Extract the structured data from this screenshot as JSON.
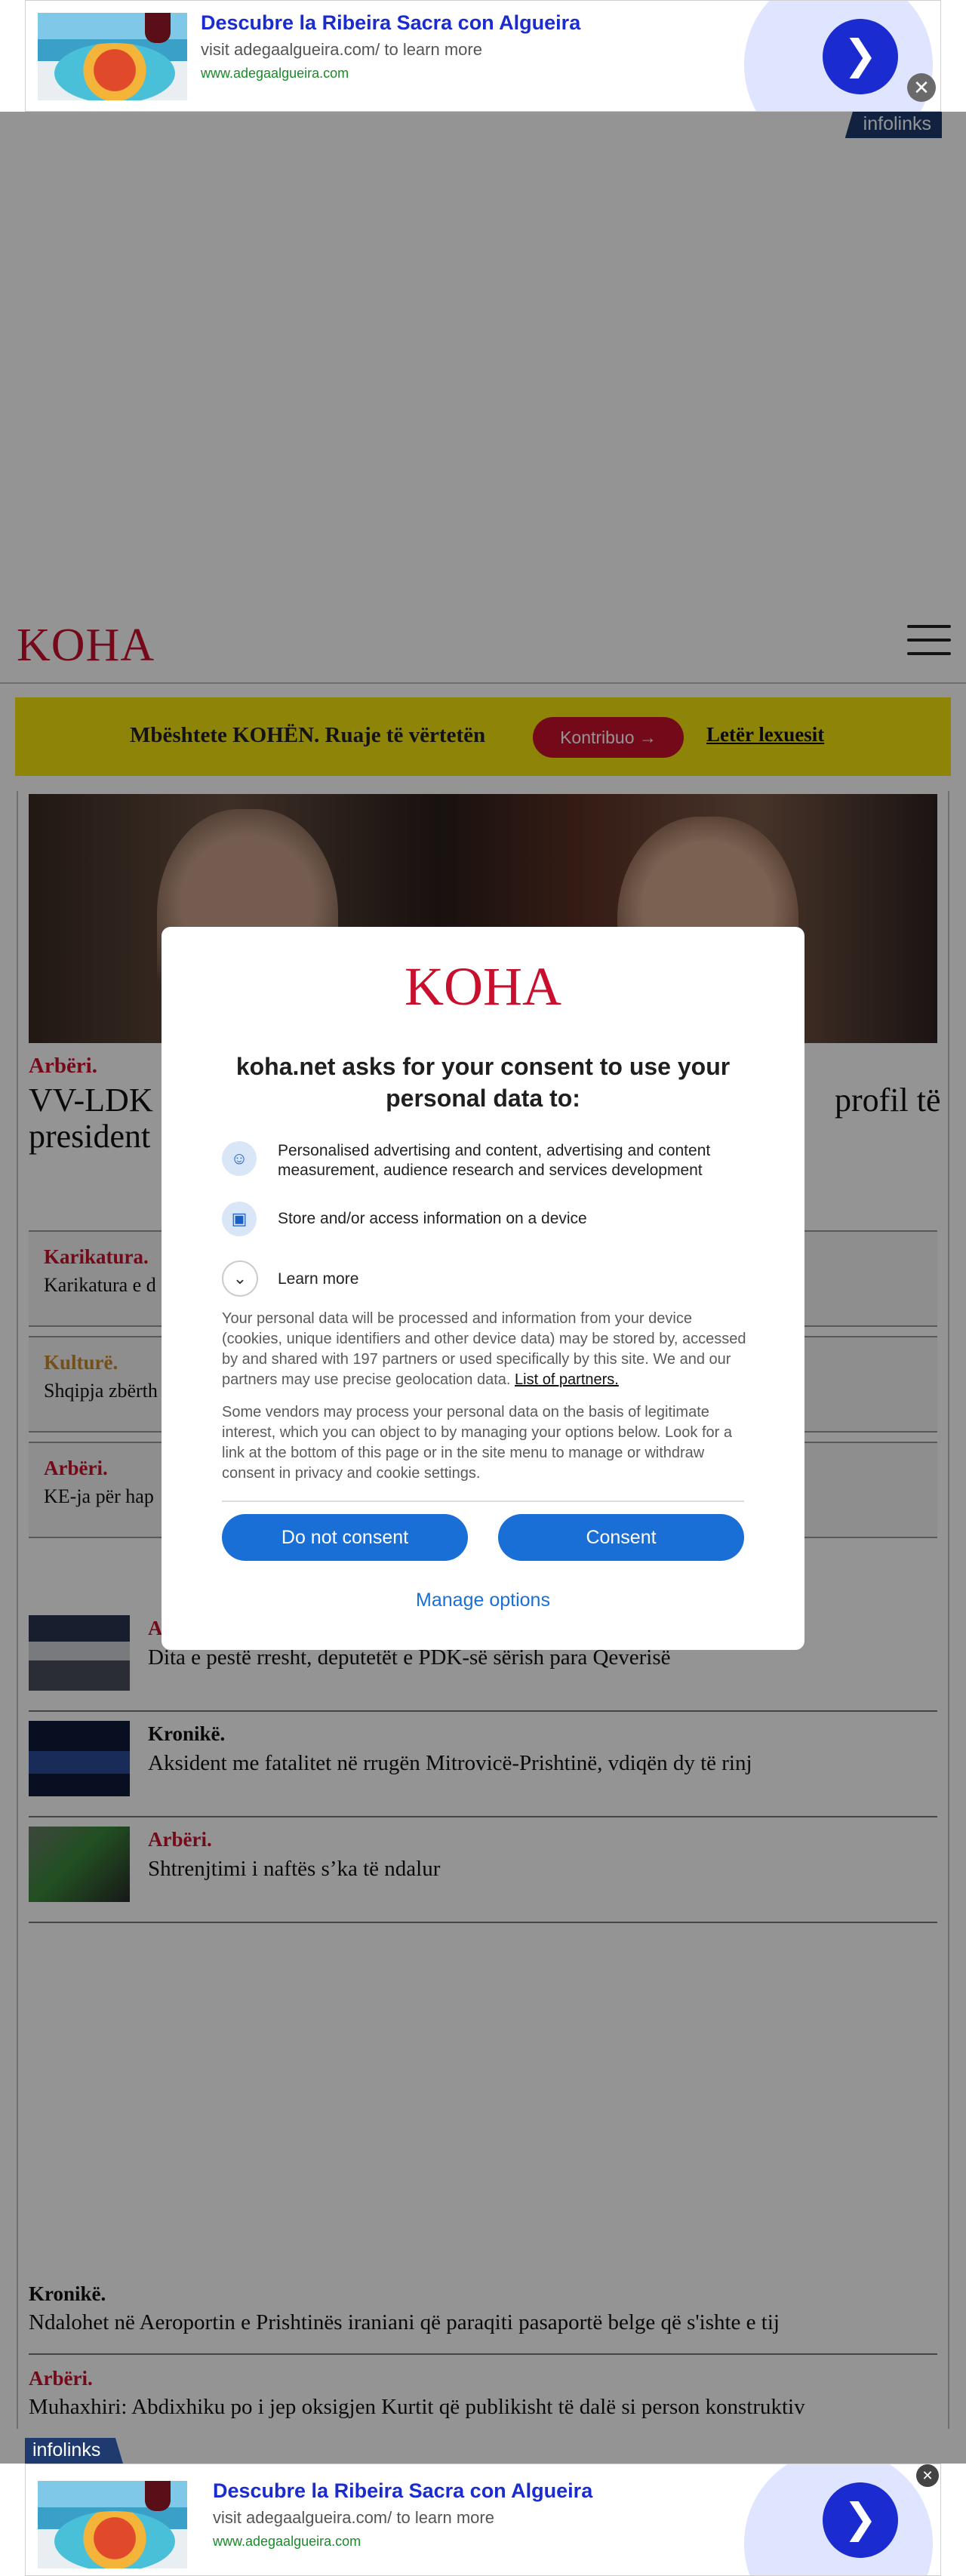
{
  "ad": {
    "title": "Descubre la Ribeira Sacra con Algueira",
    "subtitle": "visit adegaalgueira.com/ to learn more",
    "url": "www.adegaalgueira.com",
    "brand": "infolinks"
  },
  "header": {
    "logo": "KOHA"
  },
  "support": {
    "text": "Mbështete KOHËN. Ruaje të vërtetën",
    "button": "Kontribuo",
    "letter": "Letër lexuesit"
  },
  "hero": {
    "kicker": "Arbëri.",
    "title_left": "VV-LDK s",
    "title_left2": "president",
    "title_right": "profil të"
  },
  "boxes": [
    {
      "kicker": "Karikatura.",
      "text": "Karikatura e d",
      "color": "#c8102e"
    },
    {
      "kicker": "Kulturë.",
      "text": "Shqipja zbërth",
      "color": "#c8892a"
    },
    {
      "kicker": "Arbëri.",
      "text": "KE-ja për hap",
      "color": "#c8102e"
    }
  ],
  "list": [
    {
      "kicker": "A",
      "text": "Dita e pestë rresht, deputetët e PDK-së sërish para Qeverisë"
    },
    {
      "kicker": "Kronikë.",
      "text": "Aksident me fatalitet në rrugën Mitrovicë-Prishtinë, vdiqën dy të rinj"
    },
    {
      "kicker": "Arbëri.",
      "text": "Shtrenjtimi i naftës s’ka të ndalur"
    }
  ],
  "bottom": [
    {
      "kicker": "Kronikë.",
      "text": "Ndalohet në Aeroportin e Prishtinës iraniani që paraqiti pasaportë belge që s'ishte e tij"
    },
    {
      "kicker": "Arbëri.",
      "text": "Muhaxhiri: Abdixhiku po i jep oksigjen Kurtit që publikisht të dalë si person konstruktiv"
    }
  ],
  "consent": {
    "logo": "KOHA",
    "heading": "koha.net asks for your consent to use your personal data to:",
    "purposes": [
      "Personalised advertising and content, advertising and content measurement, audience research and services development",
      "Store and/or access information on a device"
    ],
    "learn_more": "Learn more",
    "para1": "Your personal data will be processed and information from your device (cookies, unique identifiers and other device data) may be stored by, accessed by and shared with 197 partners or used specifically by this site. We and our partners may use precise geolocation data.",
    "partners_link": "List of partners.",
    "para2": "Some vendors may process your personal data on the basis of legitimate interest, which you can object to by managing your options below. Look for a link at the bottom of this page or in the site menu to manage or withdraw consent in privacy and cookie settings.",
    "btn_no": "Do not consent",
    "btn_yes": "Consent",
    "manage": "Manage options"
  },
  "colors": {
    "brand_red": "#c8102e",
    "consent_blue": "#1a6fd6",
    "support_yellow": "#f3e30f"
  }
}
